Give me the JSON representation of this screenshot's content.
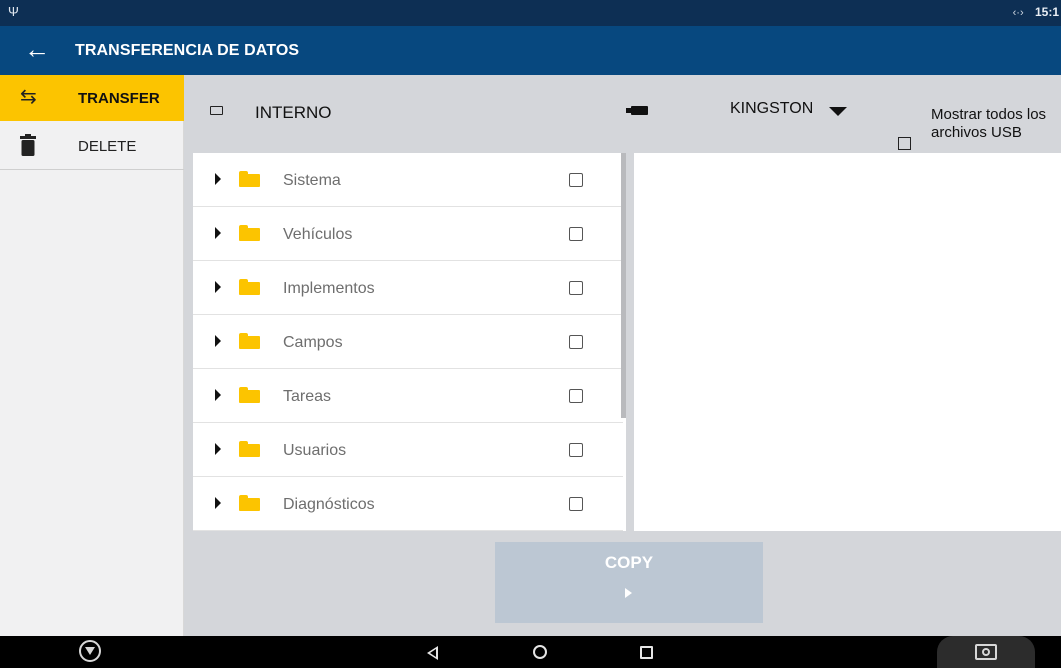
{
  "status_bar": {
    "usb_icon": "usb-icon",
    "signal_icon": "data-transfer-icon",
    "time": "15:1"
  },
  "app_bar": {
    "back_icon": "arrow-left-icon",
    "title": "TRANSFERENCIA DE DATOS"
  },
  "sidebar": {
    "items": [
      {
        "label": "TRANSFER",
        "icon": "swap-arrows-icon",
        "active": true
      },
      {
        "label": "DELETE",
        "icon": "trash-icon",
        "active": false
      }
    ]
  },
  "source": {
    "icon": "internal-storage-icon",
    "name": "INTERNO"
  },
  "destination": {
    "icon": "usb-drive-icon",
    "name": "KINGSTON",
    "dropdown_icon": "caret-down-icon"
  },
  "show_all_usb": {
    "label": "Mostrar todos los archivos USB",
    "checked": false
  },
  "folders": [
    {
      "name": "Sistema",
      "checked": false
    },
    {
      "name": "Vehículos",
      "checked": false
    },
    {
      "name": "Implementos",
      "checked": false
    },
    {
      "name": "Campos",
      "checked": false
    },
    {
      "name": "Tareas",
      "checked": false
    },
    {
      "name": "Usuarios",
      "checked": false
    },
    {
      "name": "Diagnósticos",
      "checked": false
    }
  ],
  "copy_button": {
    "label": "COPY",
    "icon": "play-icon",
    "enabled": false
  },
  "colors": {
    "status_bar": "#0d2f54",
    "app_bar": "#07487f",
    "accent": "#fcc400",
    "copy_disabled": "#bcc7d3"
  },
  "nav_bar": {
    "icons": [
      "brand-logo-icon",
      "back-triangle-icon",
      "home-circle-icon",
      "recent-apps-icon",
      "screenshot-camera-icon"
    ]
  }
}
